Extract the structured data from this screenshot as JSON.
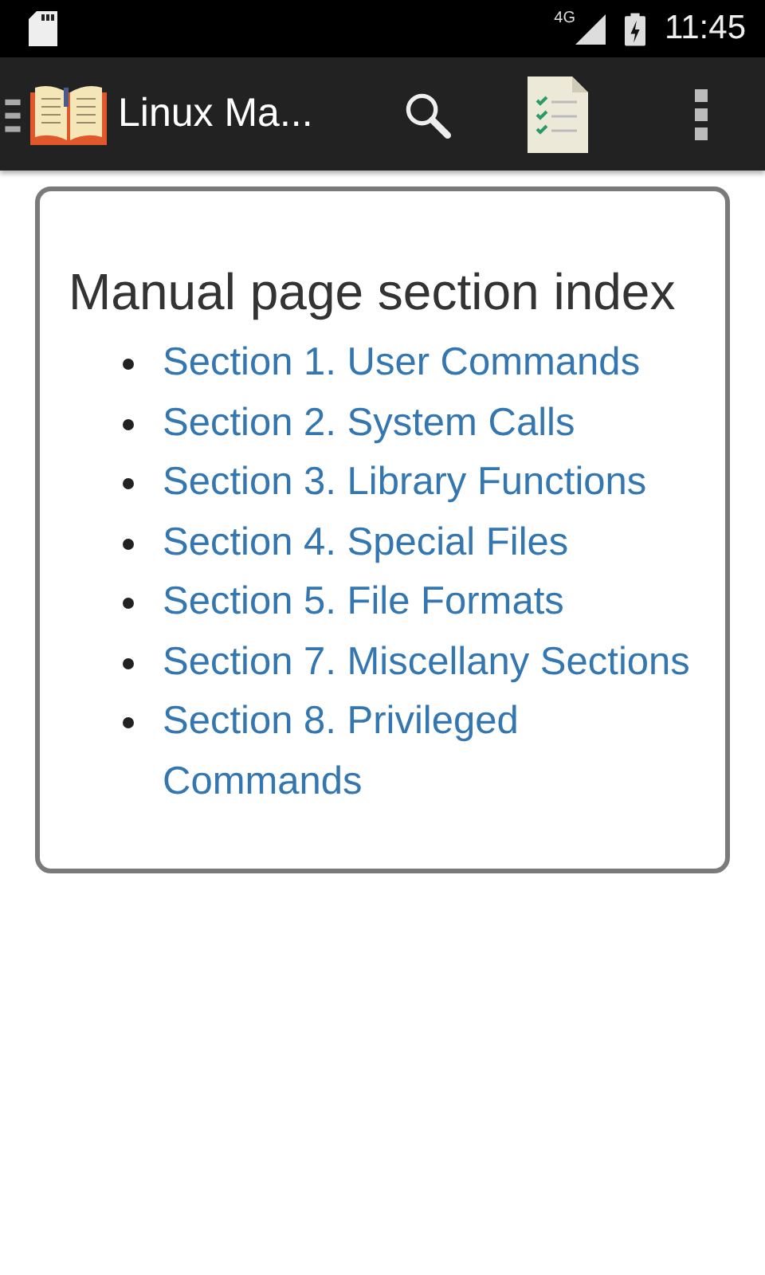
{
  "status_bar": {
    "network": "4G",
    "time": "11:45"
  },
  "app_bar": {
    "title": "Linux Ma..."
  },
  "content": {
    "heading": "Manual page section index",
    "links": [
      {
        "text": "Section 1. User Commands"
      },
      {
        "text": "Section 2. System Calls"
      },
      {
        "text": "Section 3. Library Functions"
      },
      {
        "text": "Section 4. Special Files"
      },
      {
        "text": "Section 5. File Formats"
      },
      {
        "text": "Section 7. Miscellany Sections"
      },
      {
        "text": "Section 8. Privileged Commands"
      }
    ]
  }
}
